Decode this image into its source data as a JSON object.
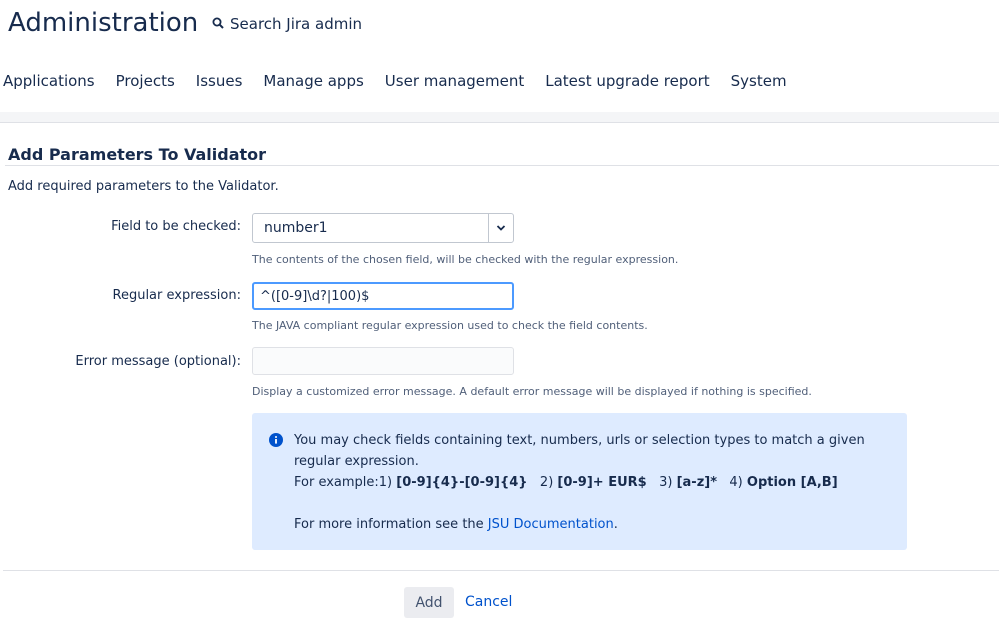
{
  "header": {
    "title": "Administration",
    "search_placeholder": "Search Jira admin"
  },
  "nav": [
    "Applications",
    "Projects",
    "Issues",
    "Manage apps",
    "User management",
    "Latest upgrade report",
    "System"
  ],
  "page": {
    "title": "Add Parameters To Validator",
    "intro": "Add required parameters to the Validator."
  },
  "form": {
    "field_label": "Field to be checked:",
    "field_value": "number1",
    "field_help": "The contents of the chosen field, will be checked with the regular expression.",
    "regex_label": "Regular expression:",
    "regex_value": "^([0-9]\\d?|100)$",
    "regex_help": "The JAVA compliant regular expression used to check the field contents.",
    "error_label": "Error message (optional):",
    "error_value": "",
    "error_help": "Display a customized error message. A default error message will be displayed if nothing is specified."
  },
  "info": {
    "line1": "You may check fields containing text, numbers, urls or selection types to match a given regular expression.",
    "example_prefix": "For example:1)",
    "ex1": "[0-9]{4}-[0-9]{4}",
    "ex2_prefix": "2)",
    "ex2": "[0-9]+ EUR$",
    "ex3_prefix": "3)",
    "ex3": "[a-z]*",
    "ex4_prefix": "4)",
    "ex4": "Option [A,B]",
    "more_prefix": "For more information see the",
    "more_link": "JSU Documentation",
    "more_suffix": "."
  },
  "buttons": {
    "add": "Add",
    "cancel": "Cancel"
  },
  "colors": {
    "link": "#0052cc",
    "info_bg": "#deebff",
    "focus": "#4c9aff"
  }
}
